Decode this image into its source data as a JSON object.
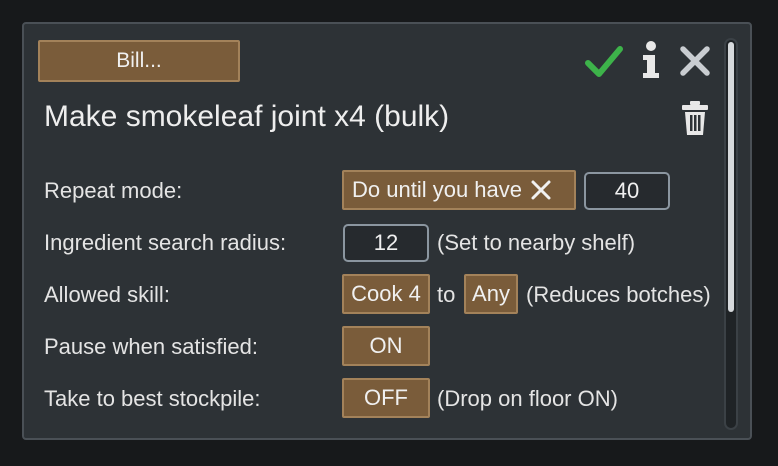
{
  "dialog": {
    "bill_button": "Bill...",
    "title": "Make smokeleaf joint x4 (bulk)"
  },
  "icons": {
    "confirm": "check-icon",
    "info": "info-icon",
    "close": "close-icon",
    "delete": "trash-icon"
  },
  "rows": {
    "repeat": {
      "label": "Repeat mode:",
      "mode": "Do until you have",
      "count": "40"
    },
    "radius": {
      "label": "Ingredient search radius:",
      "value": "12",
      "note": "(Set to nearby shelf)"
    },
    "skill": {
      "label": "Allowed skill:",
      "from": "Cook 4",
      "to_word": "to",
      "to": "Any",
      "note": "(Reduces botches)"
    },
    "pause": {
      "label": "Pause when satisfied:",
      "value": "ON"
    },
    "stockpile": {
      "label": "Take to best stockpile:",
      "value": "OFF",
      "note": "(Drop on floor ON)"
    }
  },
  "colors": {
    "accent_button": "#7a5c3a",
    "check_green": "#3db34a",
    "panel_bg": "#2d3236"
  }
}
